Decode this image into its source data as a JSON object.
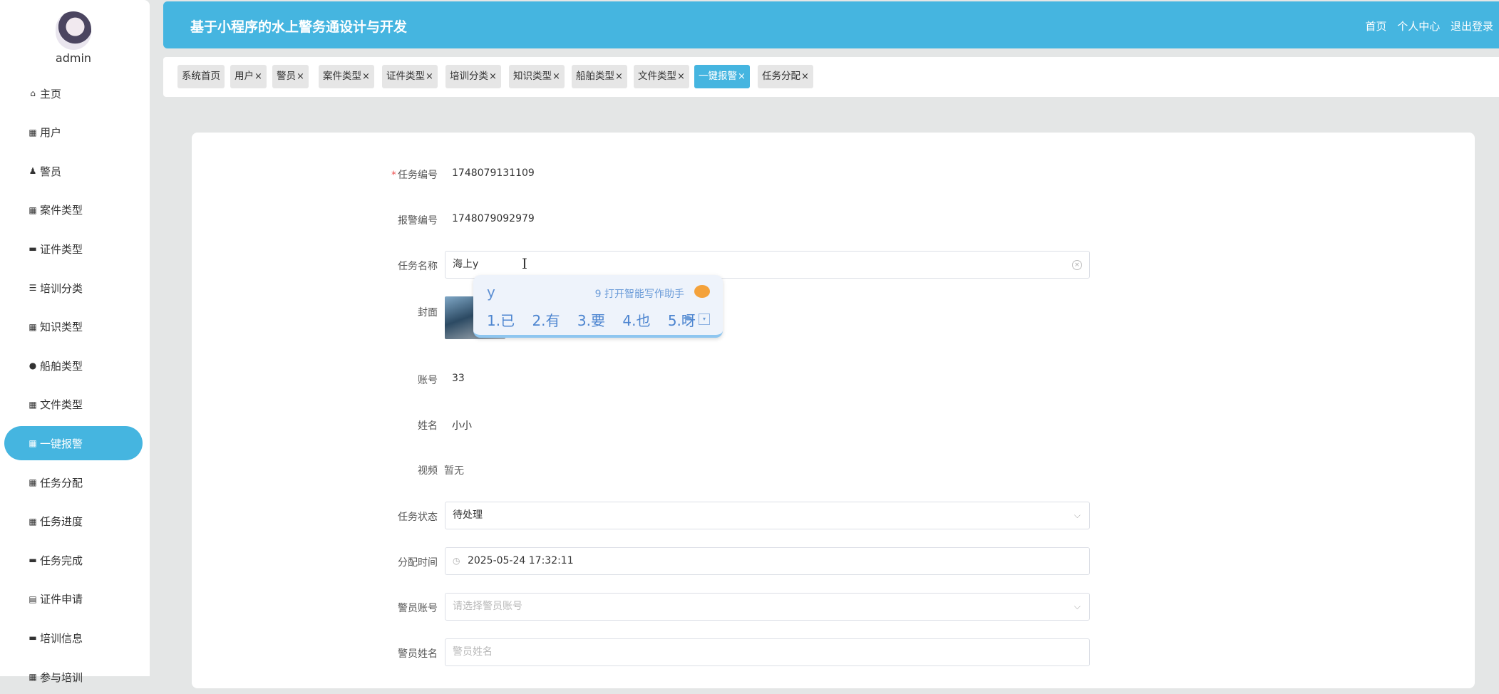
{
  "sidebar": {
    "username": "admin",
    "items": [
      {
        "label": "主页",
        "icon": "home-icon",
        "glyph": "⌂"
      },
      {
        "label": "用户",
        "icon": "grid-icon",
        "glyph": "▦"
      },
      {
        "label": "警员",
        "icon": "person-icon",
        "glyph": "♟"
      },
      {
        "label": "案件类型",
        "icon": "grid-icon",
        "glyph": "▦"
      },
      {
        "label": "证件类型",
        "icon": "briefcase-icon",
        "glyph": "▬"
      },
      {
        "label": "培训分类",
        "icon": "sliders-icon",
        "glyph": "☰"
      },
      {
        "label": "知识类型",
        "icon": "grid-icon",
        "glyph": "▦"
      },
      {
        "label": "船舶类型",
        "icon": "bulb-icon",
        "glyph": "●"
      },
      {
        "label": "文件类型",
        "icon": "grid-icon",
        "glyph": "▦"
      },
      {
        "label": "一键报警",
        "icon": "grid-icon",
        "glyph": "▦"
      },
      {
        "label": "任务分配",
        "icon": "grid-icon",
        "glyph": "▦"
      },
      {
        "label": "任务进度",
        "icon": "grid-icon",
        "glyph": "▦"
      },
      {
        "label": "任务完成",
        "icon": "drive-icon",
        "glyph": "▬"
      },
      {
        "label": "证件申请",
        "icon": "clipboard-icon",
        "glyph": "▤"
      },
      {
        "label": "培训信息",
        "icon": "briefcase-icon",
        "glyph": "▬"
      },
      {
        "label": "参与培训",
        "icon": "grid-icon",
        "glyph": "▦"
      }
    ],
    "active_index": 9
  },
  "header": {
    "title": "基于小程序的水上警务通设计与开发",
    "links": [
      "首页",
      "个人中心",
      "退出登录"
    ]
  },
  "tabs": [
    {
      "label": "系统首页",
      "closable": false
    },
    {
      "label": "用户",
      "closable": true
    },
    {
      "label": "警员",
      "closable": true
    },
    {
      "label": "案件类型",
      "closable": true
    },
    {
      "label": "证件类型",
      "closable": true
    },
    {
      "label": "培训分类",
      "closable": true
    },
    {
      "label": "知识类型",
      "closable": true
    },
    {
      "label": "船舶类型",
      "closable": true
    },
    {
      "label": "文件类型",
      "closable": true
    },
    {
      "label": "一键报警",
      "closable": true,
      "active": true
    },
    {
      "label": "任务分配",
      "closable": true
    }
  ],
  "form": {
    "task_no": {
      "label": "任务编号",
      "value": "1748079131109",
      "required": true
    },
    "alarm_no": {
      "label": "报警编号",
      "value": "1748079092979"
    },
    "task_name": {
      "label": "任务名称",
      "value": "海上y"
    },
    "cover": {
      "label": "封面"
    },
    "account": {
      "label": "账号",
      "value": "33"
    },
    "name": {
      "label": "姓名",
      "value": "小小"
    },
    "video": {
      "label": "视频",
      "value": "暂无"
    },
    "status": {
      "label": "任务状态",
      "value": "待处理"
    },
    "assign_time": {
      "label": "分配时间",
      "value": "2025-05-24 17:32:11"
    },
    "officer_account": {
      "label": "警员账号",
      "placeholder": "请选择警员账号"
    },
    "officer_name": {
      "label": "警员姓名",
      "placeholder": "警员姓名"
    }
  },
  "ime": {
    "typed": "y",
    "hint": "9 打开智能写作助手",
    "candidates": [
      "1.已",
      "2.有",
      "3.要",
      "4.也",
      "5.呀"
    ]
  },
  "colors": {
    "accent": "#45b5e0",
    "background": "#e4e6e6"
  }
}
